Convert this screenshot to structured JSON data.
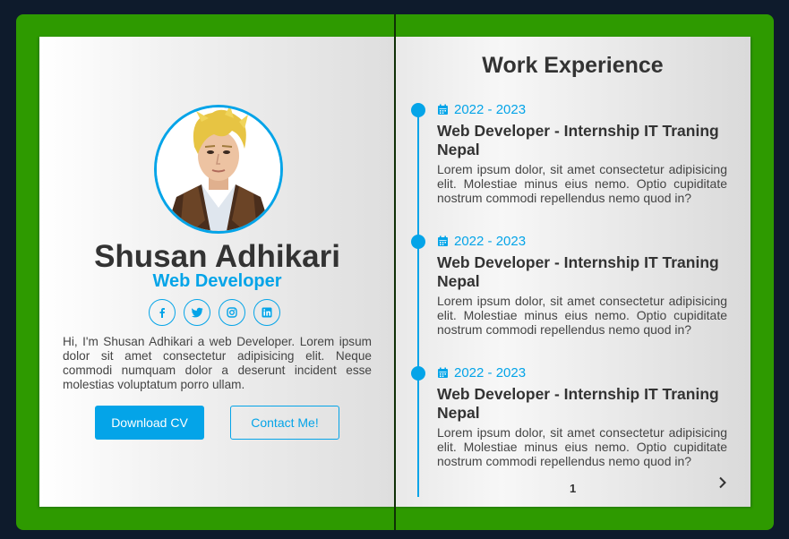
{
  "profile": {
    "name": "Shusan Adhikari",
    "role": "Web Developer",
    "bio": "Hi, I'm Shusan Adhikari a web Developer. Lorem ipsum dolor sit amet consectetur adipisicing elit. Neque commodi numquam dolor a deserunt incident esse molestias voluptatum porro ullam.",
    "socials": [
      "facebook-icon",
      "twitter-icon",
      "instagram-icon",
      "linkedin-icon"
    ],
    "download_label": "Download CV",
    "contact_label": "Contact Me!"
  },
  "experience": {
    "title": "Work Experience",
    "entries": [
      {
        "date": "2022 - 2023",
        "title": "Web Developer - Internship IT Traning Nepal",
        "description": "Lorem ipsum dolor, sit amet consectetur adipisicing elit. Molestiae minus eius nemo. Optio cupiditate nostrum commodi repellendus nemo quod in?"
      },
      {
        "date": "2022 - 2023",
        "title": "Web Developer - Internship IT Traning Nepal",
        "description": "Lorem ipsum dolor, sit amet consectetur adipisicing elit. Molestiae minus eius nemo. Optio cupiditate nostrum commodi repellendus nemo quod in?"
      },
      {
        "date": "2022 - 2023",
        "title": "Web Developer - Internship IT Traning Nepal",
        "description": "Lorem ipsum dolor, sit amet consectetur adipisicing elit. Molestiae minus eius nemo. Optio cupiditate nostrum commodi repellendus nemo quod in?"
      }
    ],
    "page_number": "1"
  },
  "colors": {
    "accent": "#04a4e8",
    "cover": "#2e9a00",
    "background": "#0e1b2c"
  }
}
